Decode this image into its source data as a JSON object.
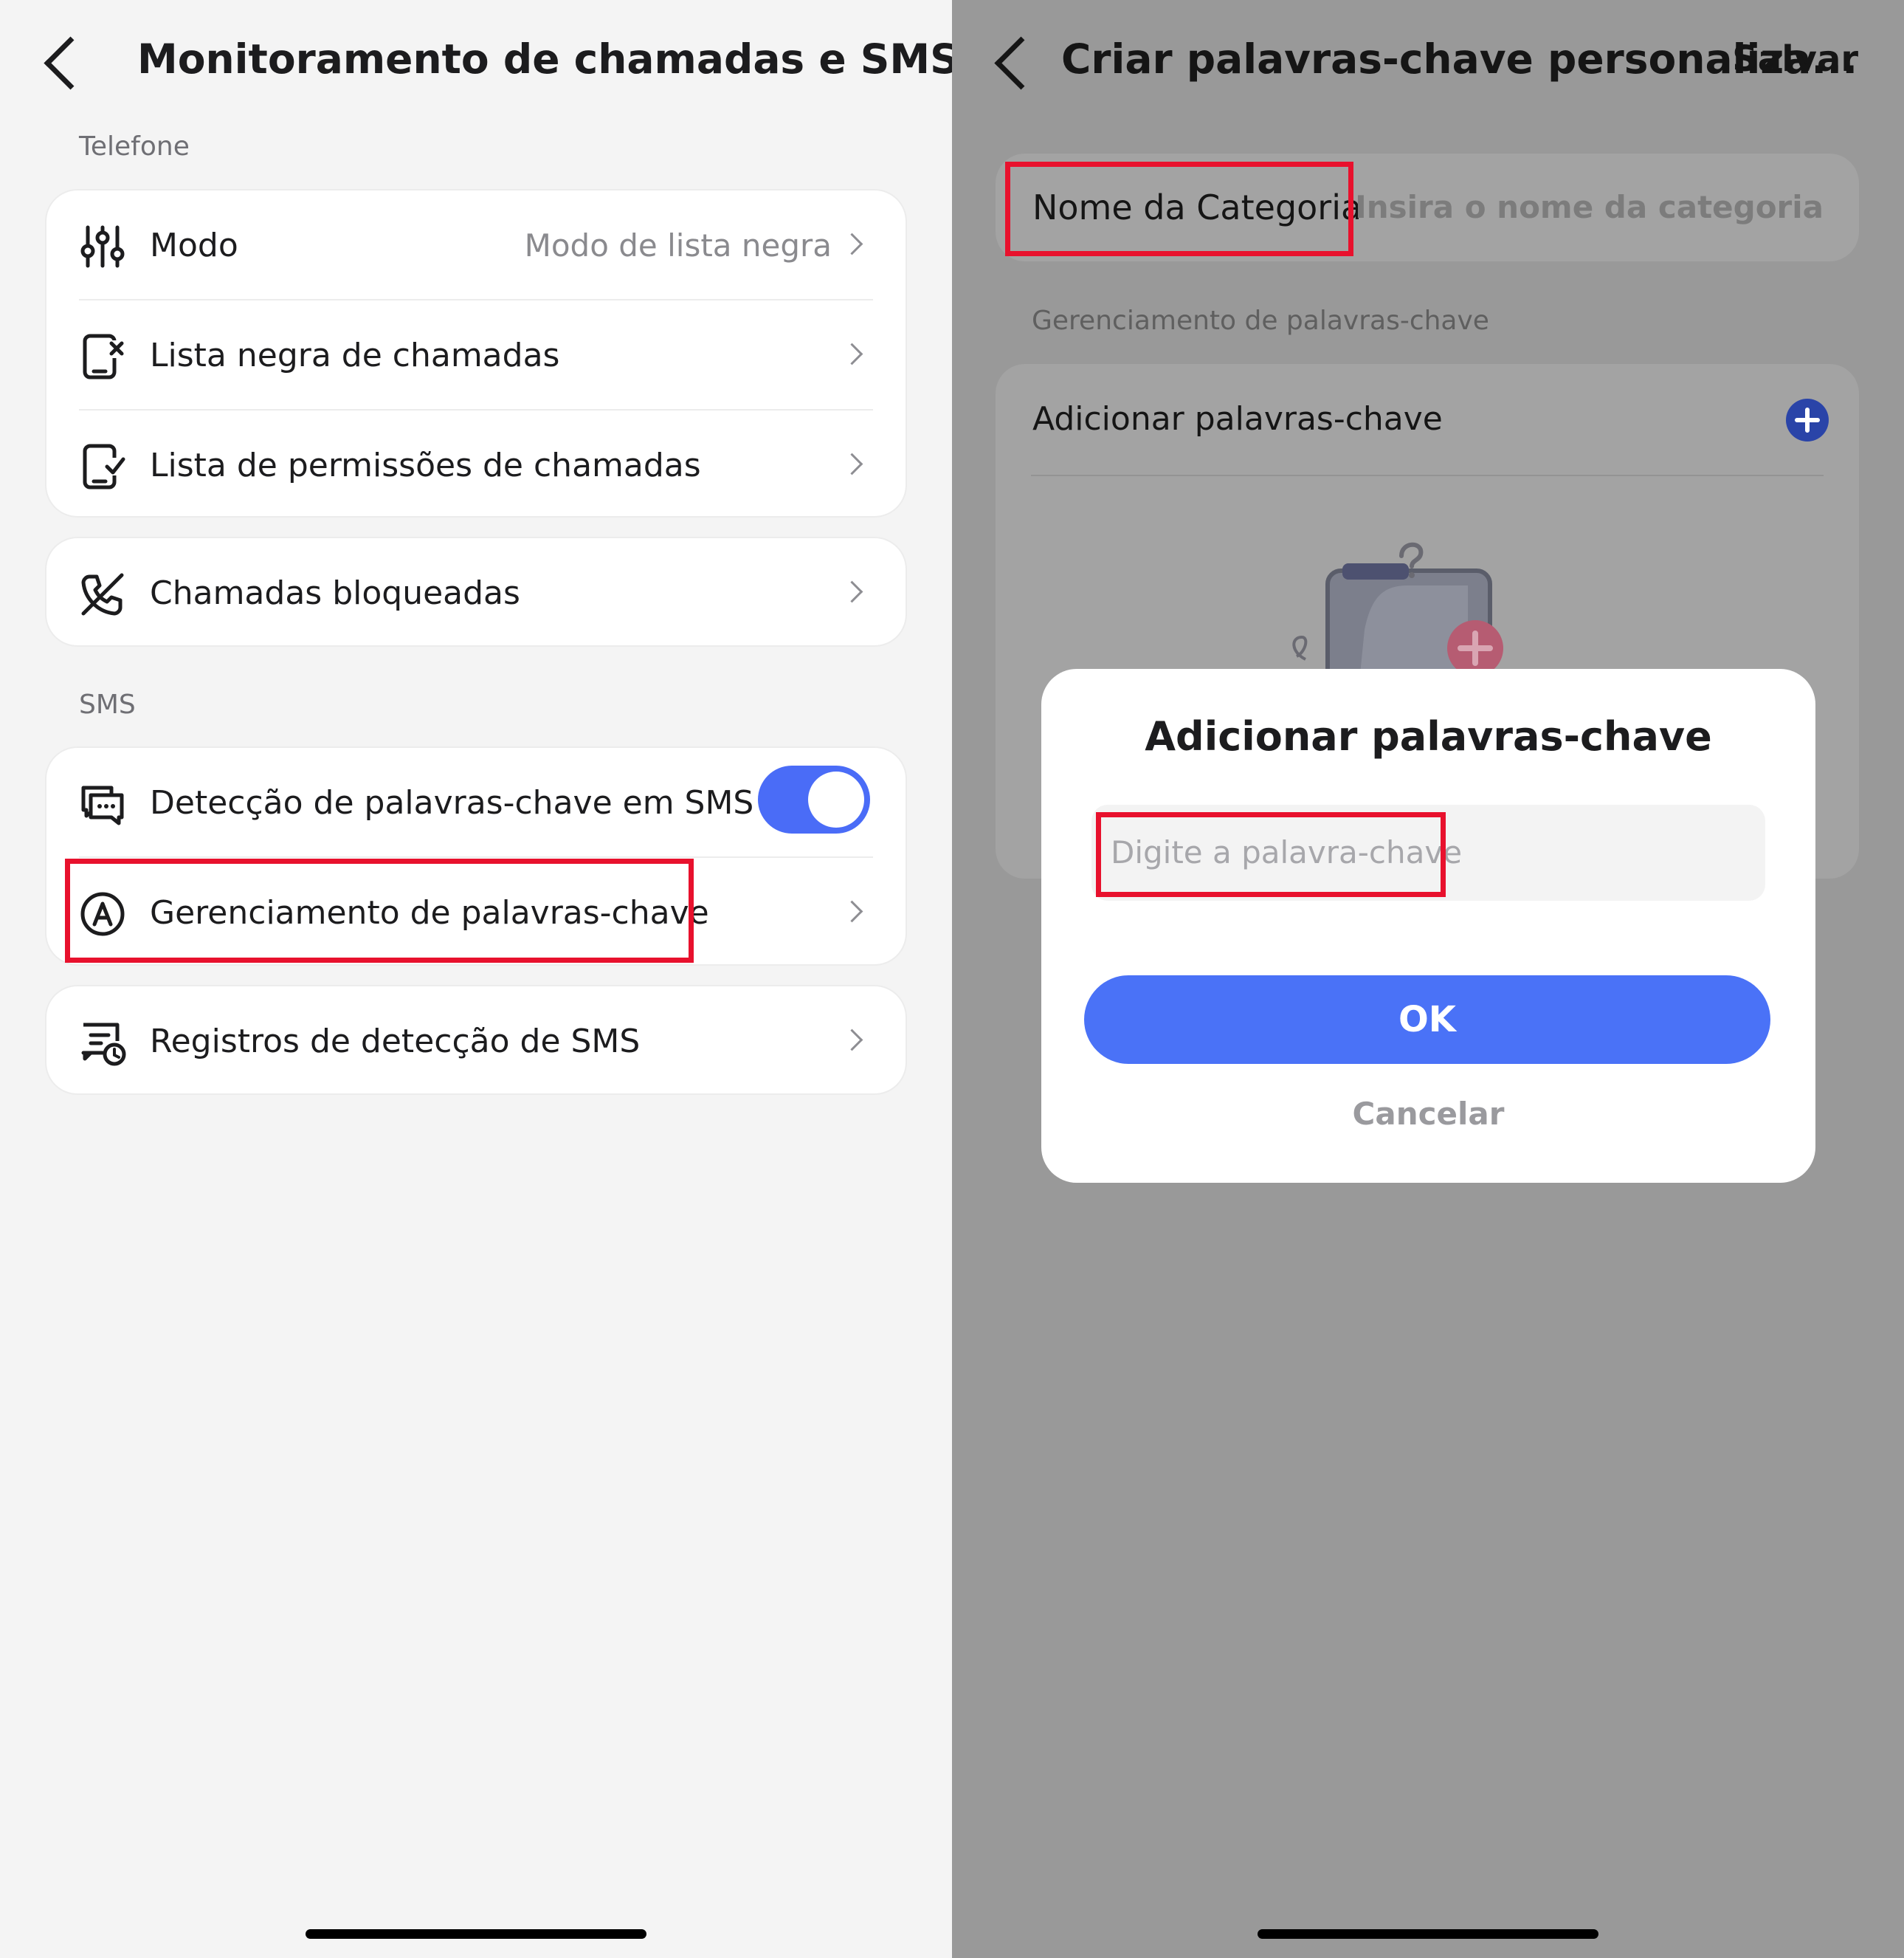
{
  "left": {
    "title": "Monitoramento de chamadas e SMS",
    "section_phone": "Telefone",
    "rows_phone": [
      {
        "label": "Modo",
        "value": "Modo de lista negra"
      },
      {
        "label": "Lista negra de chamadas"
      },
      {
        "label": "Lista de permissões de chamadas"
      }
    ],
    "blocked": {
      "label": "Chamadas bloqueadas"
    },
    "section_sms": "SMS",
    "rows_sms": [
      {
        "label": "Detecção de palavras-chave em SMS",
        "toggle": "on"
      },
      {
        "label": "Gerenciamento de palavras-chave"
      }
    ],
    "logs": {
      "label": "Registros de detecção de SMS"
    }
  },
  "right": {
    "title": "Criar palavras-chave personaliza...",
    "save": "Salvar",
    "category_label": "Nome da Categoria",
    "category_placeholder": "Insira o nome da categoria",
    "section": "Gerenciamento de palavras-chave",
    "add_label": "Adicionar palavras-chave",
    "dialog": {
      "title": "Adicionar palavras-chave",
      "placeholder": "Digite a palavra-chave",
      "ok": "OK",
      "cancel": "Cancelar"
    }
  },
  "colors": {
    "accent": "#4a6cf7",
    "highlight": "#e8112d",
    "overlay": "#999999"
  }
}
